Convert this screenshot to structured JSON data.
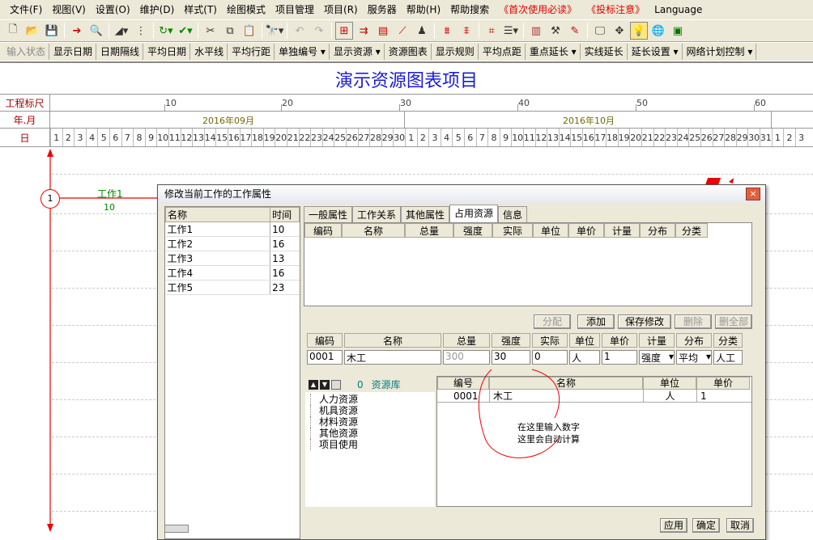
{
  "menu": [
    {
      "label": "文件(F)",
      "red": false
    },
    {
      "label": "视图(V)",
      "red": false
    },
    {
      "label": "设置(O)",
      "red": false
    },
    {
      "label": "维护(D)",
      "red": false
    },
    {
      "label": "样式(T)",
      "red": false
    },
    {
      "label": "绘图模式",
      "red": false
    },
    {
      "label": "项目管理",
      "red": false
    },
    {
      "label": "项目(R)",
      "red": false
    },
    {
      "label": "服务器",
      "red": false
    },
    {
      "label": "帮助(H)",
      "red": false
    },
    {
      "label": "帮助搜索",
      "red": false
    },
    {
      "label": "《首次使用必读》",
      "red": true
    },
    {
      "label": "《投标注意》",
      "red": true
    },
    {
      "label": "Language",
      "red": false
    }
  ],
  "toolbar2": [
    {
      "label": "输入状态",
      "dim": true
    },
    {
      "label": "显示日期",
      "dim": false
    },
    {
      "label": "日期隔线",
      "dim": false
    },
    {
      "label": "平均日期",
      "dim": false
    },
    {
      "label": "水平线",
      "dim": false
    },
    {
      "label": "平均行距",
      "dim": false
    },
    {
      "label": "单独编号 ▾",
      "dim": false
    },
    {
      "label": "显示资源 ▾",
      "dim": false
    },
    {
      "label": "资源图表",
      "dim": false
    },
    {
      "label": "显示规则",
      "dim": false
    },
    {
      "label": "平均点距",
      "dim": false
    },
    {
      "label": "重点延长 ▾",
      "dim": false
    },
    {
      "label": "实线延长",
      "dim": false
    },
    {
      "label": "延长设置 ▾",
      "dim": false
    },
    {
      "label": "网络计划控制 ▾",
      "dim": false
    }
  ],
  "chart": {
    "title": "演示资源图表项目",
    "row_labels": {
      "scale": "工程标尺",
      "month": "年.月",
      "day": "日"
    },
    "scale_ticks": [
      "10",
      "20",
      "30",
      "40",
      "50",
      "60"
    ],
    "months": [
      "2016年09月",
      "2016年10月"
    ],
    "sep_days": [
      "1",
      "2",
      "3",
      "4",
      "5",
      "6",
      "7",
      "8",
      "9",
      "10",
      "11",
      "12",
      "13",
      "14",
      "15",
      "16",
      "17",
      "18",
      "19",
      "20",
      "21",
      "22",
      "23",
      "24",
      "25",
      "26",
      "27",
      "28",
      "29",
      "30"
    ],
    "oct_days": [
      "1",
      "2",
      "3",
      "4",
      "5",
      "6",
      "7",
      "8",
      "9",
      "10",
      "11",
      "12",
      "13",
      "14",
      "15",
      "16",
      "17",
      "18",
      "19",
      "20",
      "21",
      "22",
      "23",
      "24",
      "25",
      "26",
      "27",
      "28",
      "29",
      "30",
      "31"
    ],
    "nov_days": [
      "1",
      "2",
      "3"
    ],
    "node_label": "1",
    "work_name": "工作1",
    "work_duration": "10"
  },
  "dialog": {
    "title": "修改当前工作的工作属性",
    "close": "×",
    "task_list": {
      "headers": [
        "名称",
        "时间"
      ],
      "rows": [
        [
          "工作1",
          "10"
        ],
        [
          "工作2",
          "16"
        ],
        [
          "工作3",
          "13"
        ],
        [
          "工作4",
          "16"
        ],
        [
          "工作5",
          "23"
        ]
      ]
    },
    "tabs": [
      "一般属性",
      "工作关系",
      "其他属性",
      "占用资源",
      "信息"
    ],
    "active_tab": "占用资源",
    "res_headers": [
      "编码",
      "名称",
      "总量",
      "强度",
      "实际",
      "单位",
      "单价",
      "计量",
      "分布",
      "分类"
    ],
    "buttons": {
      "assign": "分配",
      "add": "添加",
      "save": "保存修改",
      "delete": "删除",
      "delete_all": "删全部"
    },
    "edit": {
      "headers": [
        "编码",
        "名称",
        "总量",
        "强度",
        "实际",
        "单位",
        "单价",
        "计量",
        "分布",
        "分类"
      ],
      "code": "0001",
      "name": "木工",
      "total": "300",
      "intensity": "30",
      "actual": "0",
      "unit": "人",
      "price": "1",
      "measure": "强度",
      "dist": "平均",
      "category": "人工"
    },
    "library": {
      "count": "0",
      "title": "资源库",
      "tree": [
        "人力资源",
        "机具资源",
        "材料资源",
        "其他资源",
        "项目使用"
      ]
    },
    "lib_table": {
      "headers": [
        "编号",
        "名称",
        "单位",
        "单价"
      ],
      "row": [
        "0001",
        "木工",
        "人",
        "1"
      ]
    },
    "annotation": [
      "在这里输入数字",
      "这里会自动计算"
    ],
    "footer": {
      "apply": "应用",
      "ok": "确定",
      "cancel": "取消"
    }
  }
}
